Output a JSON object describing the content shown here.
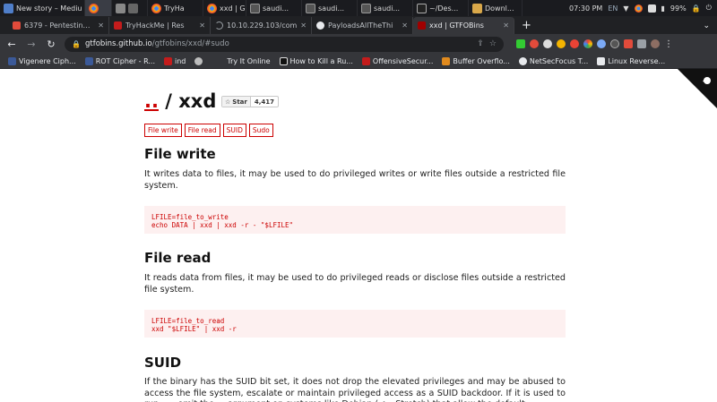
{
  "taskbar": {
    "items": [
      {
        "label": "New story – Mediu",
        "color": "#4f7ec9"
      },
      {
        "label": "",
        "color": "#e06a3c"
      },
      {
        "label": "TryHa",
        "color": "#d8d8d8"
      },
      {
        "label": "xxd | G",
        "color": "#d8d8d8"
      },
      {
        "label": "saudi...",
        "color": "#8a8a8a"
      },
      {
        "label": "saudi...",
        "color": "#8a8a8a"
      },
      {
        "label": "saudi...",
        "color": "#8a8a8a"
      },
      {
        "label": "~/Des...",
        "color": "#8a8a8a"
      },
      {
        "label": "Downl...",
        "color": "#d9a84a"
      }
    ],
    "time": "07:30 PM",
    "lang": "EN",
    "battery": "99%"
  },
  "tabs": [
    {
      "title": "6379 - Pentesting R",
      "color": "#e24b3b"
    },
    {
      "title": "TryHackMe | Res",
      "color": "#c41c1c"
    },
    {
      "title": "10.10.229.103/com",
      "color": "#9aa0a6"
    },
    {
      "title": "PayloadsAllTheThi",
      "color": "#e8eaed"
    },
    {
      "title": "xxd | GTFOBins",
      "color": "#a00000"
    }
  ],
  "toolbar": {
    "url_host": "gtfobins.github.io",
    "url_path": "/gtfobins/xxd/#sudo"
  },
  "bookmarks": [
    {
      "label": "Vigenere Ciph...",
      "color": "#3b5998"
    },
    {
      "label": "ROT Cipher - R...",
      "color": "#3b5998"
    },
    {
      "label": "ind",
      "color": "#c41c1c"
    },
    {
      "label": "",
      "color": "#bdbdbd"
    },
    {
      "label": "Try It Online",
      "color": "#e8eaed"
    },
    {
      "label": "How to Kill a Ru...",
      "color": "#e8eaed"
    },
    {
      "label": "OffensiveSecur...",
      "color": "#c41c1c"
    },
    {
      "label": "Buffer Overflo...",
      "color": "#e08a1e"
    },
    {
      "label": "NetSecFocus T...",
      "color": "#e8eaed"
    },
    {
      "label": "Linux Reverse...",
      "color": "#e8eaed"
    }
  ],
  "page": {
    "title_link": "..",
    "title_sep": " / ",
    "title_name": "xxd",
    "star_label": "Star",
    "star_count": "4,417",
    "badges": [
      "File write",
      "File read",
      "SUID",
      "Sudo"
    ],
    "sections": {
      "file_write": {
        "heading": "File write",
        "text": "It writes data to files, it may be used to do privileged writes or write files outside a restricted file system.",
        "code_line1": "LFILE=file_to_write",
        "code_line2": "echo DATA | xxd | xxd -r - \"$LFILE\""
      },
      "file_read": {
        "heading": "File read",
        "text": "It reads data from files, it may be used to do privileged reads or disclose files outside a restricted file system.",
        "code_line1": "LFILE=file_to_read",
        "code_line2": "xxd \"$LFILE\" | xxd -r"
      },
      "suid": {
        "heading": "SUID",
        "text": "If the binary has the SUID bit set, it does not drop the elevated privileges and may be abused to access the file system, escalate or maintain privileged access as a SUID backdoor. If it is used to run ... , omit the ... argument on systems like Debian (<= Stretch) that allow the default ..."
      }
    }
  }
}
